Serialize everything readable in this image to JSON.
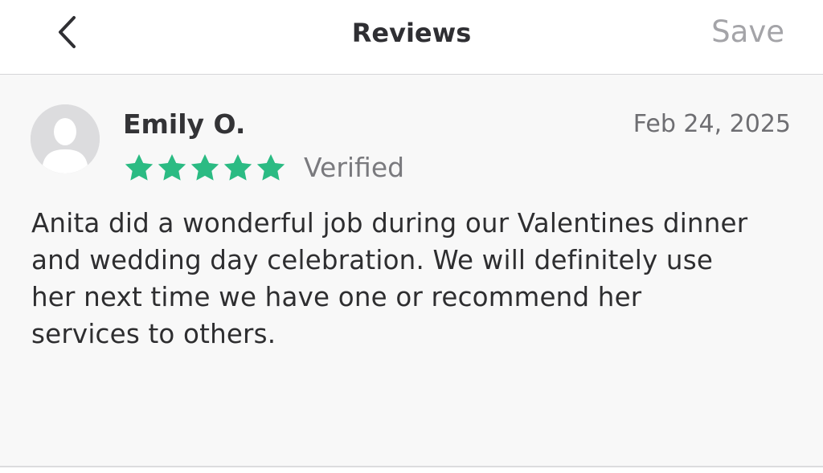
{
  "header": {
    "title": "Reviews",
    "back_icon": "chevron-left-icon",
    "save_label": "Save"
  },
  "review": {
    "avatar_icon": "user-silhouette-icon",
    "reviewer_name": "Emily O.",
    "date": "Feb 24, 2025",
    "rating": 5,
    "rating_max": 5,
    "star_icon": "star-icon",
    "verified_label": "Verified",
    "text": "Anita did a wonderful job during our Valentines dinner and wedding day celebration. We will definitely use her next time we have one or recommend her services to others."
  },
  "colors": {
    "star": "#2bbb83",
    "header_bg": "#ffffff",
    "content_bg": "#f8f8f8",
    "save_text": "#a4a4a8",
    "avatar_bg": "#dcdcde"
  }
}
